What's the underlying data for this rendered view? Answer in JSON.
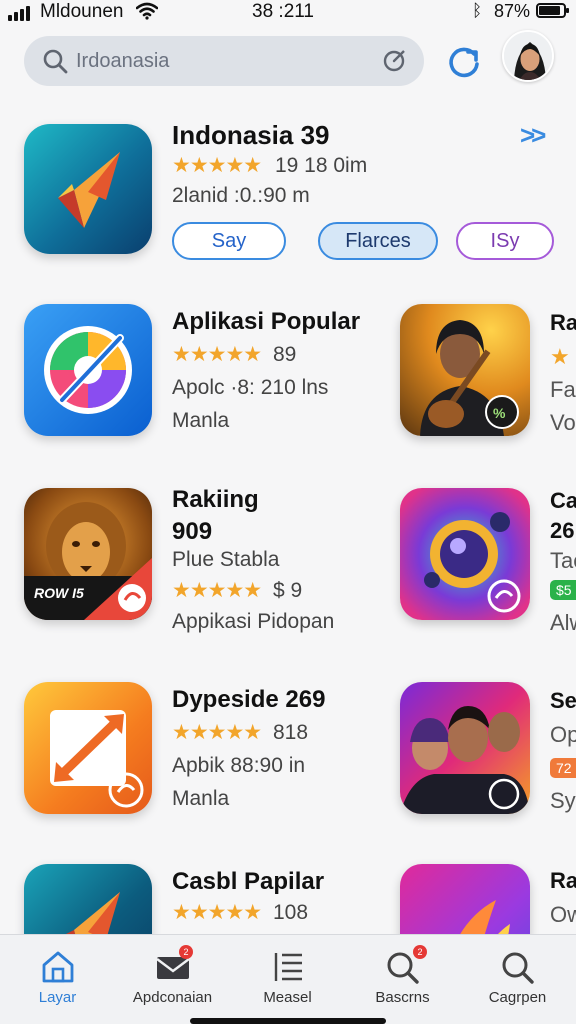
{
  "status_bar": {
    "carrier": "Mldounen",
    "time": "38 :211",
    "battery_percent": "87%",
    "battery_level": 0.87
  },
  "search": {
    "placeholder": "Irdoanasia"
  },
  "featured": {
    "title": "Indonasia 39",
    "rating_text": "19 18 0im",
    "stars": 4.5,
    "meta": "2lanid :0.:90 m",
    "more_label": ">>",
    "chips": [
      "Say",
      "Flarces",
      "ISy"
    ]
  },
  "apps": [
    {
      "name": "Aplikasi Popular",
      "rating_text": "89",
      "stars": 5,
      "line1": "Apolc ·8: 210 lns",
      "line2": "Manla"
    },
    {
      "name": "Rakiing",
      "name2": "909",
      "line1": "Plue Stabla",
      "rating_text": "$ 9",
      "stars": 5,
      "line2": "Appikasi Pidopan"
    },
    {
      "name": "Dypeside 269",
      "rating_text": "818",
      "stars": 4.5,
      "line1": "Apbik 88:90 in",
      "line2": "Manla"
    },
    {
      "name": "Casbl Papilar",
      "rating_text": "108",
      "stars": 4.5
    }
  ],
  "thumbs": [
    {
      "peek_title": "Ra",
      "peek_line1": "Far",
      "peek_line2": "Vo"
    },
    {
      "peek_title": "Ca",
      "peek_title2": "26",
      "peek_line1": "Tac",
      "badge": "$5",
      "peek_line2": "Alw"
    },
    {
      "peek_title": "Se",
      "peek_line1": "Op",
      "badge": "72",
      "peek_line2": "Sy"
    },
    {
      "peek_title": "Ra",
      "peek_line1": "Ow"
    }
  ],
  "tabs": [
    {
      "label": "Layar",
      "icon": "home-icon",
      "active": true
    },
    {
      "label": "Apdconaian",
      "icon": "mail-icon",
      "badge": "2"
    },
    {
      "label": "Measel",
      "icon": "list-icon"
    },
    {
      "label": "Bascrns",
      "icon": "search-icon",
      "badge": "2"
    },
    {
      "label": "Cagrpen",
      "icon": "search-icon"
    }
  ],
  "colors": {
    "accent": "#3a8be0",
    "star": "#f2a52b",
    "badge": "#e53935"
  }
}
